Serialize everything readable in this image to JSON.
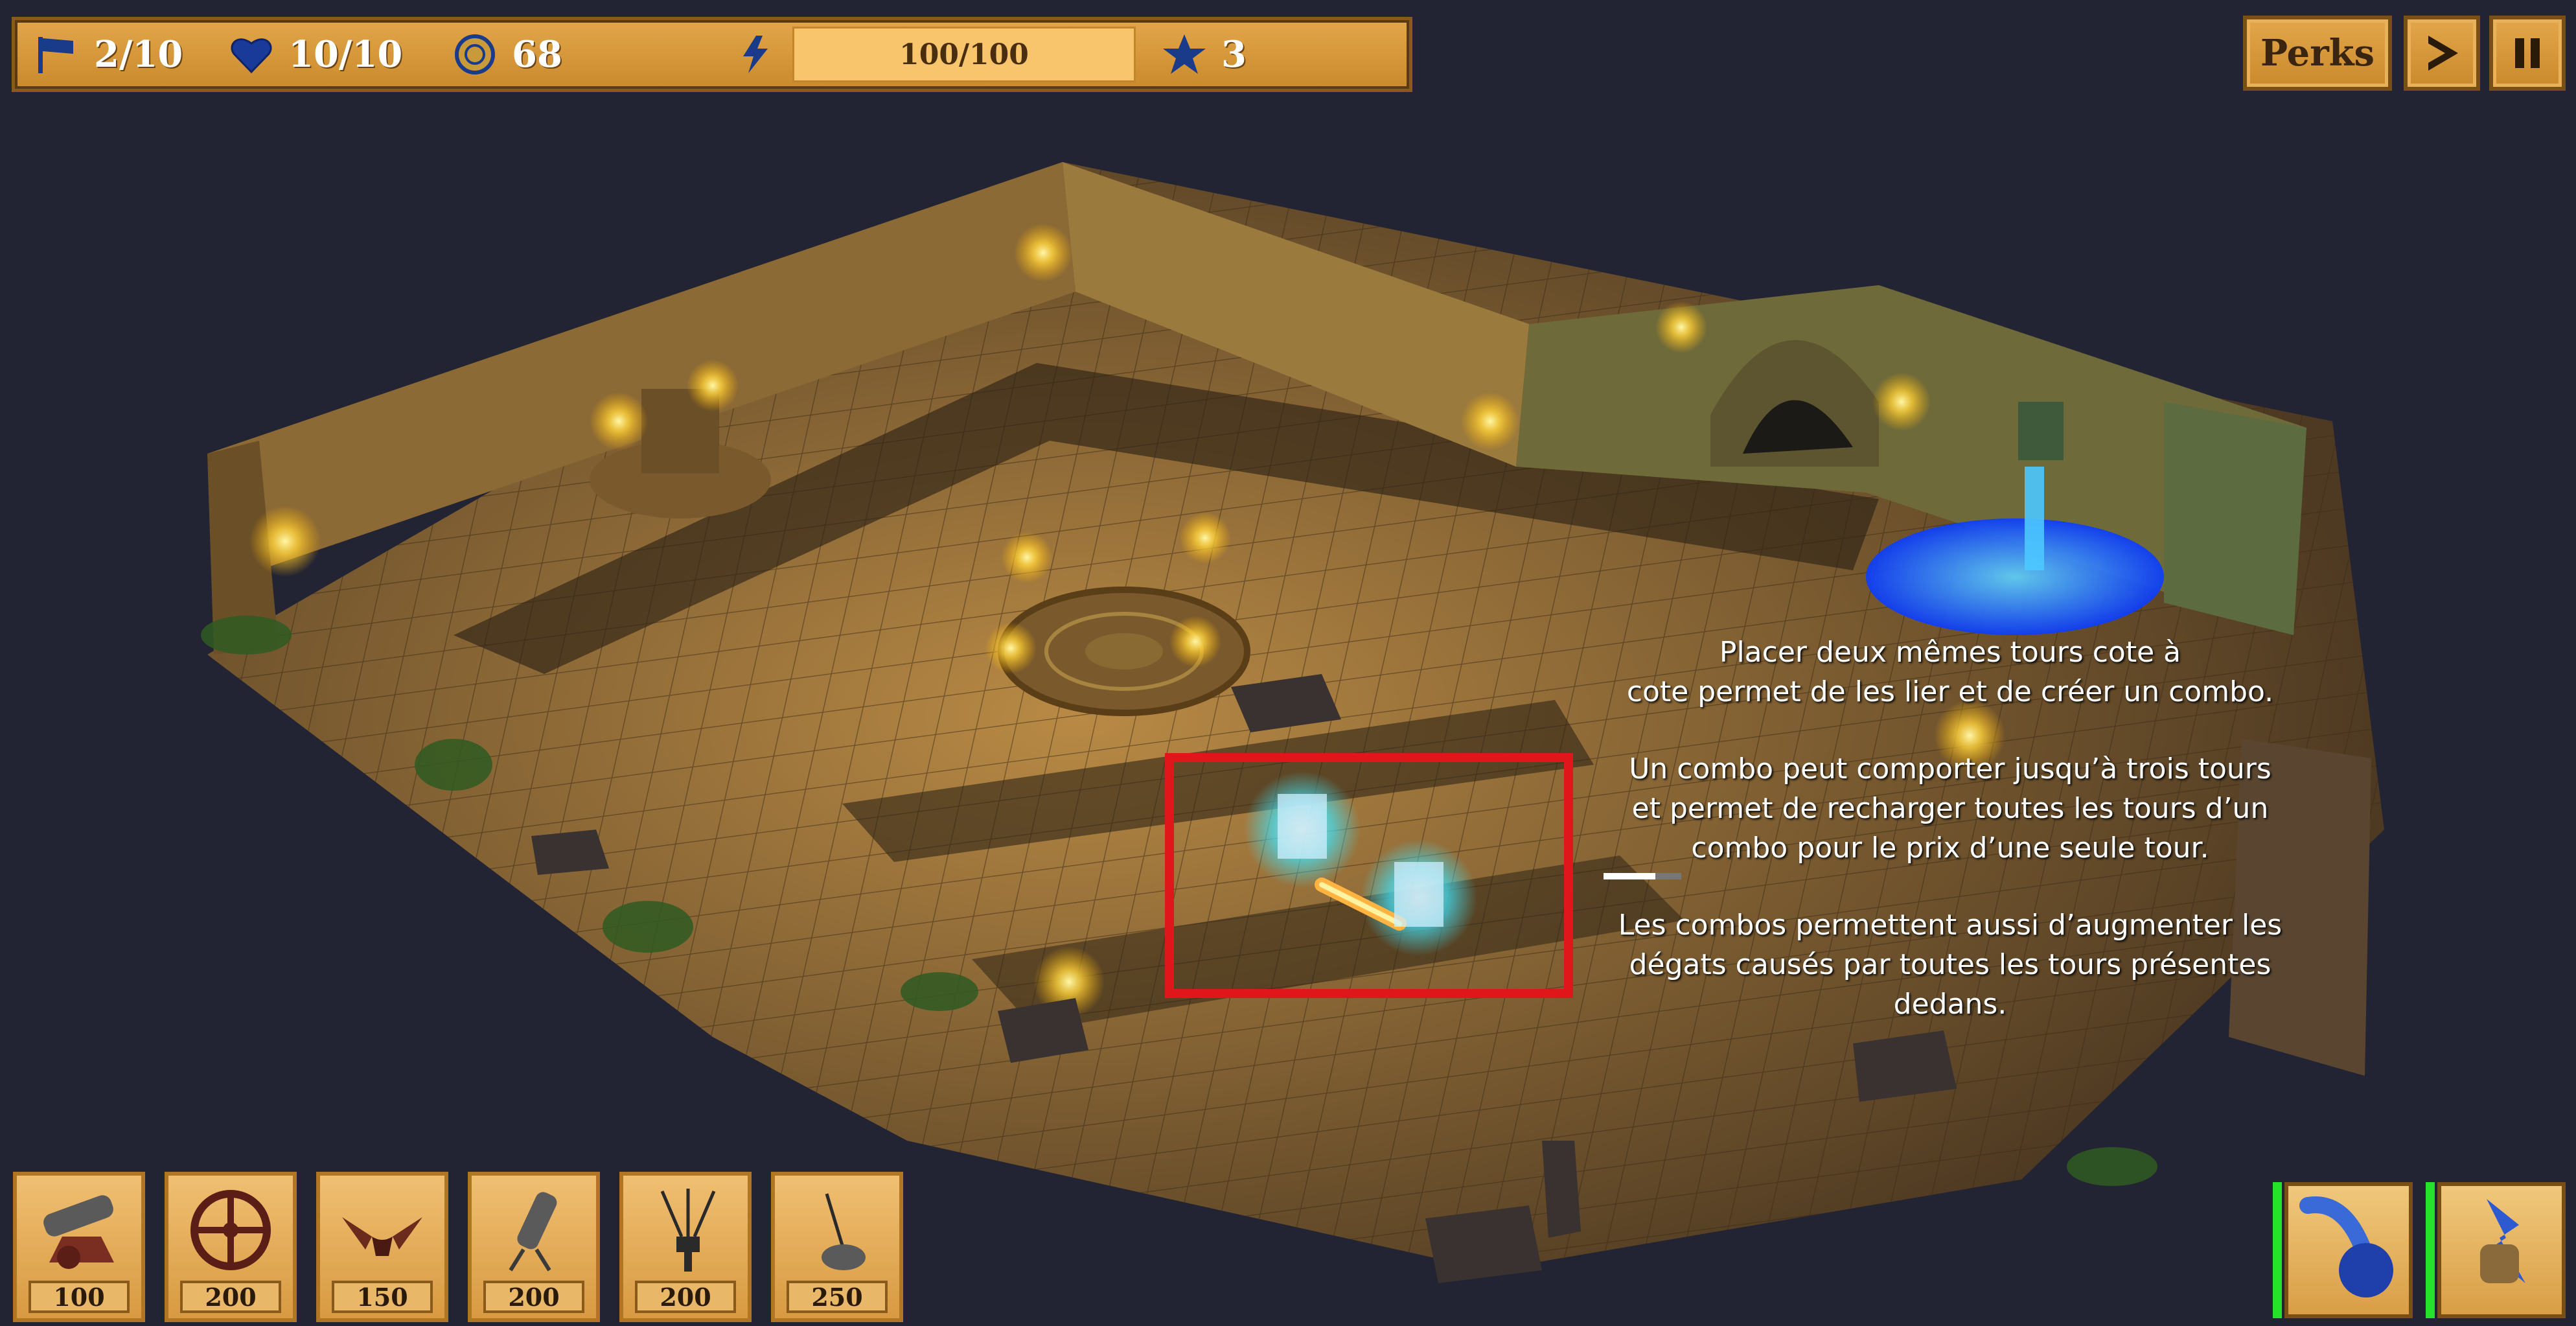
{
  "hud": {
    "wave": "2/10",
    "lives": "10/10",
    "gold": "68",
    "energy_text": "100/100",
    "energy_fraction": 1.0,
    "stars": "3",
    "icons": [
      "flag-icon",
      "heart-icon",
      "coin-icon",
      "lightning-icon",
      "star-icon"
    ]
  },
  "buttons": {
    "perks": "Perks",
    "play_icon": "play-icon",
    "pause_icon": "pause-icon"
  },
  "tutorial": {
    "para1": "Placer deux mêmes tours cote à\ncote permet de les lier et de créer un combo.",
    "para2": "Un combo peut comporter jusqu’à trois tours\net permet de recharger toutes les tours d’un\ncombo pour le prix d’une seule tour.",
    "para3": "Les combos permettent aussi d’augmenter les\ndégats causés par toutes les tours présentes\ndedans."
  },
  "towers": [
    {
      "icon": "cannon-icon",
      "price": "100"
    },
    {
      "icon": "crosshair-wheel-icon",
      "price": "200"
    },
    {
      "icon": "flamethrower-icon",
      "price": "150"
    },
    {
      "icon": "mortar-icon",
      "price": "200"
    },
    {
      "icon": "lightning-rod-icon",
      "price": "200"
    },
    {
      "icon": "catapult-icon",
      "price": "250"
    }
  ],
  "abilities": [
    {
      "icon": "meteor-icon",
      "ready": true
    },
    {
      "icon": "lightning-fist-icon",
      "ready": true
    }
  ],
  "colors": {
    "background": "#232433",
    "hud_gold": "#d9993b",
    "highlight_red": "#e0171a",
    "tower_glow": "#3fe6ff",
    "ready_green": "#24e32a"
  }
}
